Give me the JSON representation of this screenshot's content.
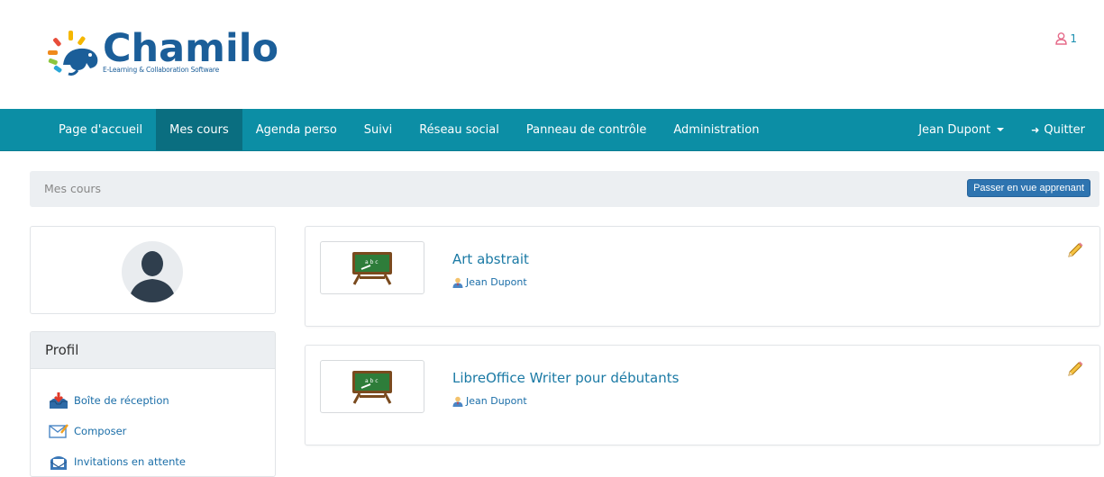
{
  "brand": {
    "name": "Chamilo",
    "tagline": "E-Learning & Collaboration Software",
    "color": "#1b5e99"
  },
  "header": {
    "users_online": "1"
  },
  "nav": {
    "items": [
      {
        "label": "Page d'accueil"
      },
      {
        "label": "Mes cours",
        "active": true
      },
      {
        "label": "Agenda perso"
      },
      {
        "label": "Suivi"
      },
      {
        "label": "Réseau social"
      },
      {
        "label": "Panneau de contrôle"
      },
      {
        "label": "Administration"
      }
    ],
    "user_menu": "Jean Dupont",
    "logout": "Quitter",
    "bar_color": "#0c8ea5"
  },
  "breadcrumb": {
    "current": "Mes cours",
    "switch_button": "Passer en vue apprenant"
  },
  "profile": {
    "title": "Profil",
    "items": [
      {
        "label": "Boîte de réception",
        "icon": "inbox-icon"
      },
      {
        "label": "Composer",
        "icon": "compose-mail-icon"
      },
      {
        "label": "Invitations en attente",
        "icon": "invitations-icon"
      }
    ]
  },
  "courses": [
    {
      "title": "Art abstrait",
      "teacher": "Jean Dupont",
      "icon": "blackboard-icon"
    },
    {
      "title": "LibreOffice Writer pour débutants",
      "teacher": "Jean Dupont",
      "icon": "blackboard-icon"
    }
  ]
}
